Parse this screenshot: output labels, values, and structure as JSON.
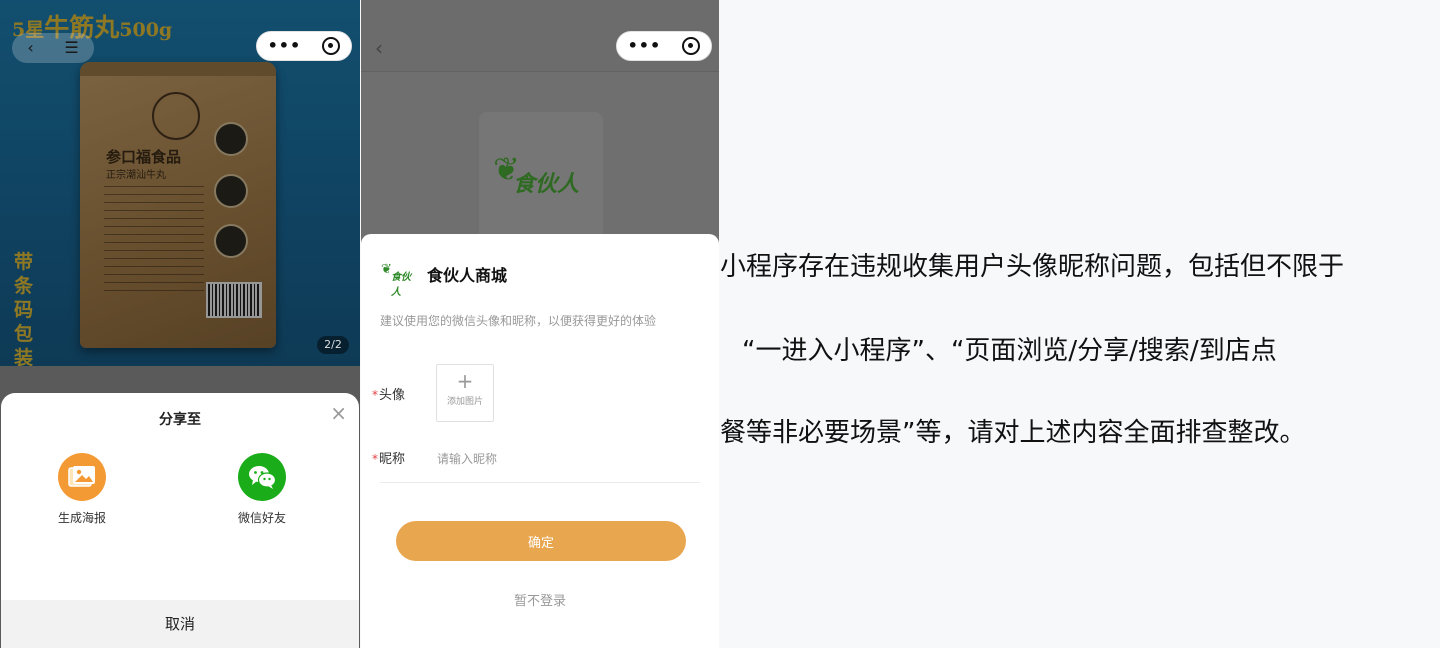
{
  "product_page": {
    "headline_part1": "5星",
    "headline_part2": "牛筋丸",
    "headline_part3": "500g",
    "side_note": "带条码包装",
    "bag_brand": "参口福食品",
    "bag_sub": "正宗潮汕牛丸",
    "back_glyph": "‹",
    "menu_glyph": "☰",
    "more_glyph": "•••",
    "page_indicator": "2/2"
  },
  "share_sheet": {
    "title": "分享至",
    "close_glyph": "×",
    "options": [
      {
        "label": "生成海报",
        "icon": "poster-icon",
        "color": "#f49a34"
      },
      {
        "label": "微信好友",
        "icon": "wechat-icon",
        "color": "#1aad19"
      }
    ],
    "cancel_label": "取消"
  },
  "login_page": {
    "back_glyph": "‹",
    "more_glyph": "•••",
    "logo_text": "食伙人",
    "app_name": "食伙人商城",
    "description": "建议使用您的微信头像和昵称，以便获得更好的体验",
    "required_mark": "*",
    "avatar_label": "头像",
    "avatar_plus": "+",
    "avatar_add_text": "添加图片",
    "nickname_label": "昵称",
    "nickname_placeholder": "请输入昵称",
    "confirm_label": "确定",
    "skip_label": "暂不登录",
    "accent_color": "#e8a64f"
  },
  "notice": {
    "line1": "小程序存在违规收集用户头像昵称问题，包括但不限于",
    "line2": "“一进入小程序”、“页面浏览/分享/搜索/到店点",
    "line3": "餐等非必要场景”等，请对上述内容全面排查整改。"
  }
}
